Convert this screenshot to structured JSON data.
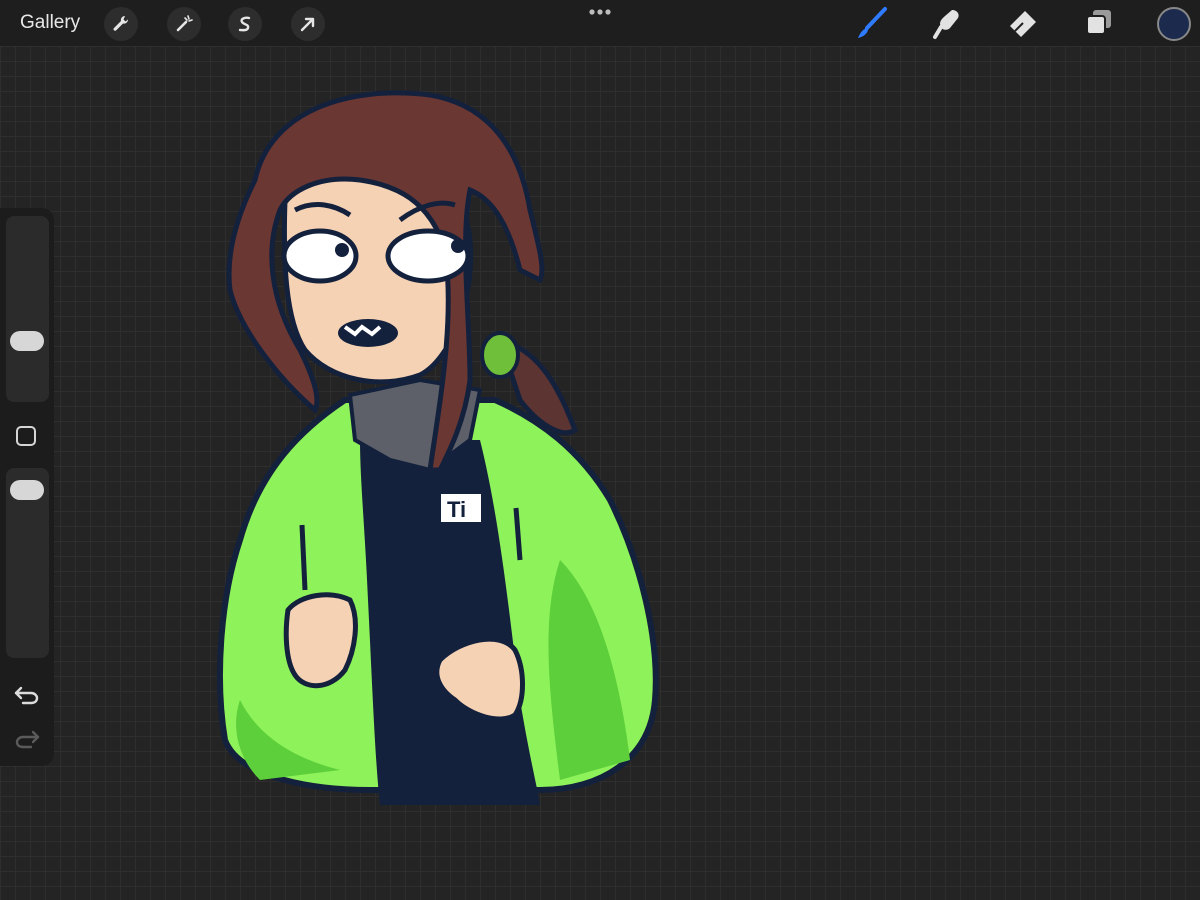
{
  "toolbar": {
    "gallery_label": "Gallery",
    "left_tools": [
      "wrench-icon",
      "magic-wand-icon",
      "selection-s-icon",
      "transform-arrow-icon"
    ],
    "right_tools": [
      "brush-icon",
      "smudge-icon",
      "eraser-icon",
      "layers-icon"
    ],
    "active_tool": "brush",
    "active_color": "#1b2a4d",
    "accent_color": "#2f7bff"
  },
  "sidebar": {
    "size_slider_level": 0.3,
    "opacity_slider_level": 0.95,
    "buttons": [
      "modify-button",
      "undo-icon",
      "redo-icon"
    ]
  },
  "artwork": {
    "shirt_text": "Ti"
  }
}
